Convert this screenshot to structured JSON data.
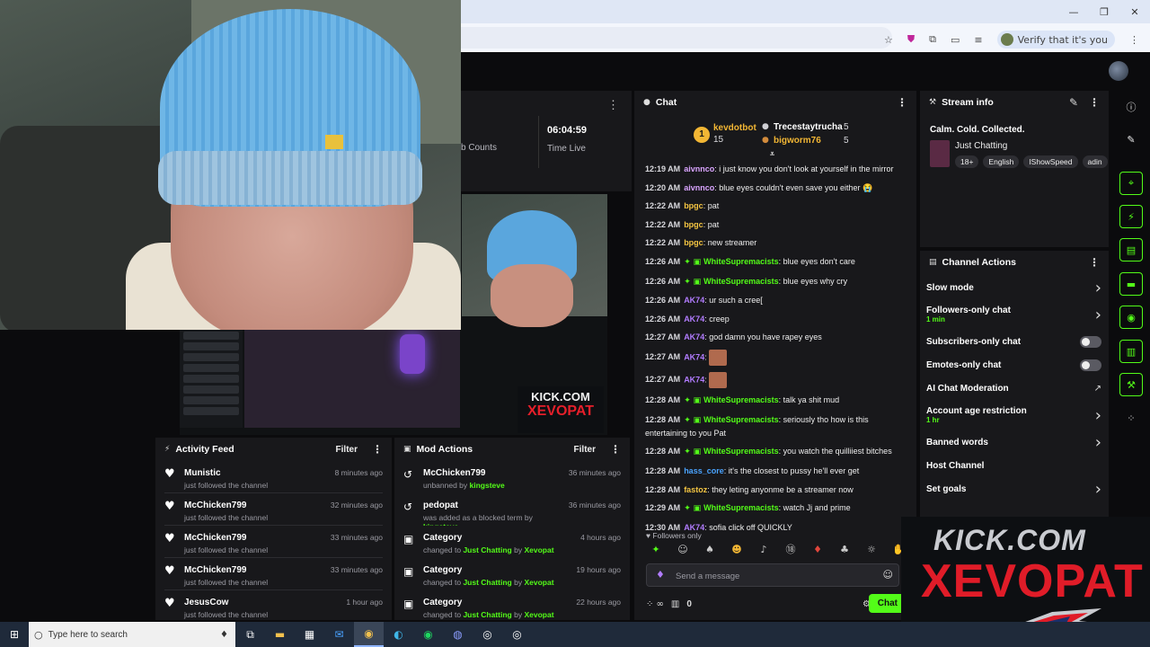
{
  "browser": {
    "verify_label": "Verify that it's you",
    "window_controls": [
      "—",
      "❐",
      "✕"
    ],
    "toolbar_icons": [
      "star-icon",
      "shield-icon",
      "extensions-icon",
      "cast-icon",
      "tab-search-icon",
      "more-icon"
    ]
  },
  "preview": {
    "sub_counts_label": "b Counts",
    "time_live_value": "06:04:59",
    "time_live_label": "Time Live"
  },
  "video_overlay": {
    "kick_line1": "KICK.COM",
    "kick_line2": "XEVOPAT"
  },
  "activity_feed": {
    "title": "Activity Feed",
    "filter_label": "Filter",
    "items": [
      {
        "name": "Munistic",
        "sub": "just followed the channel",
        "time": "8 minutes ago"
      },
      {
        "name": "McChicken799",
        "sub": "just followed the channel",
        "time": "32 minutes ago"
      },
      {
        "name": "McChicken799",
        "sub": "just followed the channel",
        "time": "33 minutes ago"
      },
      {
        "name": "McChicken799",
        "sub": "just followed the channel",
        "time": "33 minutes ago"
      },
      {
        "name": "JesusCow",
        "sub": "just followed the channel",
        "time": "1 hour ago"
      }
    ]
  },
  "mod_actions": {
    "title": "Mod Actions",
    "filter_label": "Filter",
    "items": [
      {
        "name": "McChicken799",
        "sub_pre": "unbanned by ",
        "sub_hl": "kingsteve",
        "sub_mid": "",
        "sub_hl2": "",
        "time": "36 minutes ago"
      },
      {
        "name": "pedopat",
        "sub_pre": "was added as a blocked term by ",
        "sub_hl": "kingsteve",
        "sub_mid": "",
        "sub_hl2": "",
        "time": "36 minutes ago"
      },
      {
        "name": "Category",
        "sub_pre": "changed to ",
        "sub_hl": "Just Chatting",
        "sub_mid": " by ",
        "sub_hl2": "Xevopat",
        "time": "4 hours ago"
      },
      {
        "name": "Category",
        "sub_pre": "changed to ",
        "sub_hl": "Just Chatting",
        "sub_mid": " by ",
        "sub_hl2": "Xevopat",
        "time": "19 hours ago"
      },
      {
        "name": "Category",
        "sub_pre": "changed to ",
        "sub_hl": "Just Chatting",
        "sub_mid": " by ",
        "sub_hl2": "Xevopat",
        "time": "22 hours ago"
      }
    ]
  },
  "chat": {
    "title": "Chat",
    "leaderboard": {
      "first_name": "kevdotbot",
      "first_rank": "1",
      "first_count": "15",
      "second_name": "Trecestaytrucha",
      "second_count": "5",
      "third_name": "bigworm76",
      "third_count": "5"
    },
    "messages": [
      {
        "time": "12:19 AM",
        "user": "aivnnco",
        "color": "#d9a4ff",
        "badge": "",
        "text": ": i just know you don't look at yourself in the mirror"
      },
      {
        "time": "12:20 AM",
        "user": "aivnnco",
        "color": "#d9a4ff",
        "badge": "",
        "text": ": blue eyes couldn't even save you either 😭"
      },
      {
        "time": "12:22 AM",
        "user": "bpgc",
        "color": "#f4c542",
        "badge": "",
        "text": ": pat"
      },
      {
        "time": "12:22 AM",
        "user": "bpgc",
        "color": "#f4c542",
        "badge": "",
        "text": ": pat"
      },
      {
        "time": "12:22 AM",
        "user": "bpgc",
        "color": "#f4c542",
        "badge": "",
        "text": ": new streamer"
      },
      {
        "time": "12:26 AM",
        "user": "WhiteSupremacists",
        "color": "#53fc18",
        "badge": "✦ ▣",
        "text": ": blue eyes don't care"
      },
      {
        "time": "12:26 AM",
        "user": "WhiteSupremacists",
        "color": "#53fc18",
        "badge": "✦ ▣",
        "text": ": blue eyes why cry"
      },
      {
        "time": "12:26 AM",
        "user": "AK74",
        "color": "#b27cff",
        "badge": "",
        "text": ": ur such a cree["
      },
      {
        "time": "12:26 AM",
        "user": "AK74",
        "color": "#b27cff",
        "badge": "",
        "text": ": creep"
      },
      {
        "time": "12:27 AM",
        "user": "AK74",
        "color": "#b27cff",
        "badge": "",
        "text": ": god damn you have rapey eyes"
      },
      {
        "time": "12:27 AM",
        "user": "AK74",
        "color": "#b27cff",
        "badge": "",
        "text": ":",
        "emote": true
      },
      {
        "time": "12:27 AM",
        "user": "AK74",
        "color": "#b27cff",
        "badge": "",
        "text": ":",
        "emote": true
      },
      {
        "time": "12:28 AM",
        "user": "WhiteSupremacists",
        "color": "#53fc18",
        "badge": "✦ ▣",
        "text": ": talk ya shit mud"
      },
      {
        "time": "12:28 AM",
        "user": "WhiteSupremacists",
        "color": "#53fc18",
        "badge": "✦ ▣",
        "text": ": seriously tho how is this entertaining to you Pat"
      },
      {
        "time": "12:28 AM",
        "user": "WhiteSupremacists",
        "color": "#53fc18",
        "badge": "✦ ▣",
        "text": ": you watch the quilliiest bitches"
      },
      {
        "time": "12:28 AM",
        "user": "hass_core",
        "color": "#4aa3ff",
        "badge": "",
        "text": ": it's the closest to pussy he'll ever get"
      },
      {
        "time": "12:28 AM",
        "user": "fastoz",
        "color": "#f4c542",
        "badge": "",
        "text": ": they leting anyonme be a streamer now"
      },
      {
        "time": "12:29 AM",
        "user": "WhiteSupremacists",
        "color": "#53fc18",
        "badge": "✦ ▣",
        "text": ": watch Jj and prime"
      },
      {
        "time": "12:30 AM",
        "user": "AK74",
        "color": "#b27cff",
        "badge": "",
        "text": ": sofia click off QUICKLY"
      }
    ],
    "followers_only_label": "Followers only",
    "send_placeholder": "Send a message",
    "points": "0",
    "chat_button": "Chat"
  },
  "stream_info": {
    "title": "Stream info",
    "stream_title": "Calm. Cold. Collected.",
    "category": "Just Chatting",
    "tags": [
      "18+",
      "English",
      "IShowSpeed",
      "adin"
    ]
  },
  "channel_actions": {
    "title": "Channel Actions",
    "items": [
      {
        "label": "Slow mode",
        "sub": "",
        "control": "chevron"
      },
      {
        "label": "Followers-only chat",
        "sub": "1 min",
        "control": "chevron"
      },
      {
        "label": "Subscribers-only chat",
        "sub": "",
        "control": "toggle"
      },
      {
        "label": "Emotes-only chat",
        "sub": "",
        "control": "toggle"
      },
      {
        "label": "AI Chat Moderation",
        "sub": "",
        "control": "external"
      },
      {
        "label": "Account age restriction",
        "sub": "1 hr",
        "control": "chevron"
      },
      {
        "label": "Banned words",
        "sub": "",
        "control": "chevron"
      },
      {
        "label": "Host Channel",
        "sub": "",
        "control": "none"
      },
      {
        "label": "Set goals",
        "sub": "",
        "control": "chevron"
      }
    ]
  },
  "kick_overlay": {
    "line1": "KICK.COM",
    "line2": "XEVOPAT"
  },
  "taskbar": {
    "search_placeholder": "Type here to search"
  }
}
